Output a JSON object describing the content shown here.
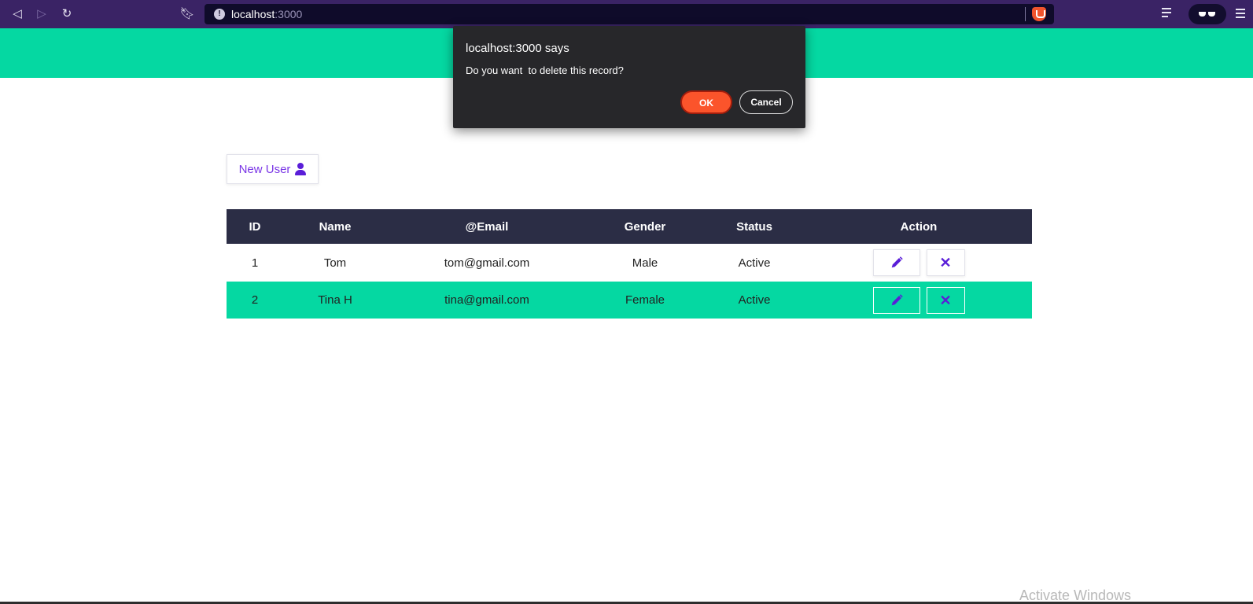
{
  "browser": {
    "url_host": "localhost",
    "url_port": ":3000"
  },
  "dialog": {
    "title": "localhost:3000 says",
    "message": "Do you want  to delete this record?",
    "ok_label": "OK",
    "cancel_label": "Cancel"
  },
  "toolbar": {
    "new_user_label": "New User"
  },
  "table": {
    "headers": [
      "ID",
      "Name",
      "@Email",
      "Gender",
      "Status",
      "Action"
    ],
    "rows": [
      {
        "id": "1",
        "name": "Tom",
        "email": "tom@gmail.com",
        "gender": "Male",
        "status": "Active"
      },
      {
        "id": "2",
        "name": "Tina H",
        "email": "tina@gmail.com",
        "gender": "Female",
        "status": "Active"
      }
    ]
  },
  "icons": {
    "edit": "pencil-icon",
    "delete": "x-icon",
    "new_user": "user-icon"
  },
  "colors": {
    "accent_green": "#05d8a2",
    "header_dark": "#2b2d45",
    "purple": "#5a1ed8",
    "ok_orange": "#fb542b"
  },
  "watermark": "Activate Windows"
}
